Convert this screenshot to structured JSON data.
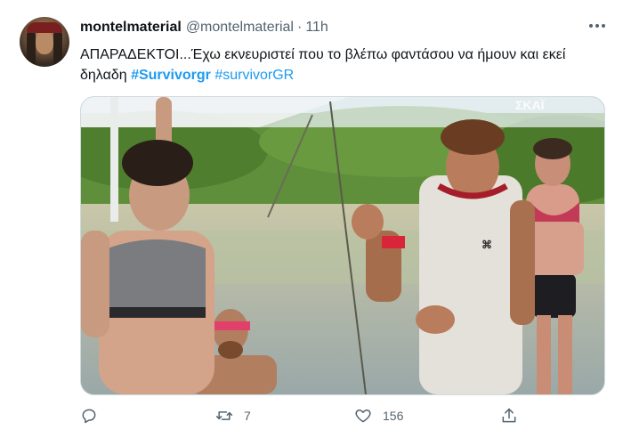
{
  "tweet": {
    "author": {
      "display_name": "montelmaterial",
      "handle": "@montelmaterial"
    },
    "separator": "·",
    "time": "11h",
    "text_plain": "ΑΠΑΡΑΔΕΚΤΟΙ...Έχω εκνευριστεί που το βλέπω φαντάσου να ήμουν και εκεί δηλαδη ",
    "hashtags": [
      "#Survivorgr",
      "#survivorGR"
    ],
    "media": {
      "watermark": "ΣΚΑΪ"
    },
    "actions": {
      "reply_count": "",
      "retweet_count": "7",
      "like_count": "156"
    }
  },
  "icons": {
    "more": "more-dots-icon",
    "reply": "reply-icon",
    "retweet": "retweet-icon",
    "like": "heart-icon",
    "share": "share-icon"
  },
  "colors": {
    "link": "#1d9bf0",
    "secondary_text": "#536471",
    "primary_text": "#0f1419"
  }
}
